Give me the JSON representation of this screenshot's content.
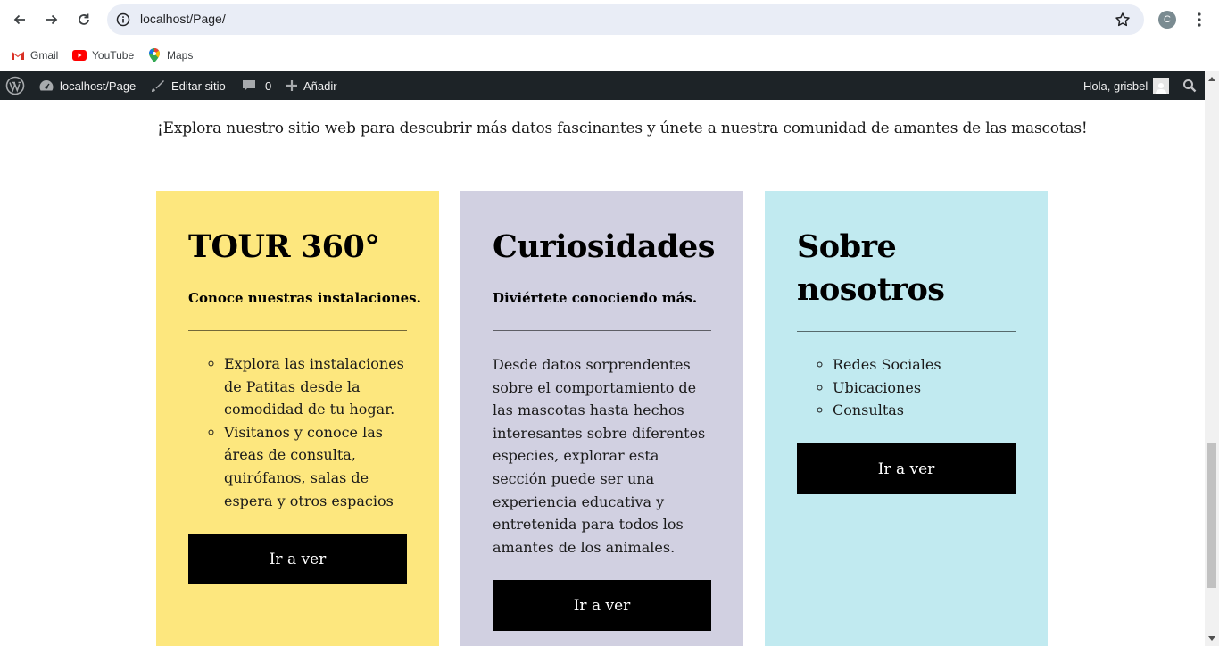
{
  "browser": {
    "url": "localhost/Page/",
    "profile_initial": "C",
    "bookmarks": [
      {
        "label": "Gmail",
        "icon": "gmail-icon"
      },
      {
        "label": "YouTube",
        "icon": "youtube-icon"
      },
      {
        "label": "Maps",
        "icon": "maps-icon"
      }
    ]
  },
  "admin_bar": {
    "site": "localhost/Page",
    "edit": "Editar sitio",
    "comments": "0",
    "add": "Añadir",
    "greeting": "Hola, grisbel"
  },
  "page": {
    "intro": "¡Explora nuestro sitio web para descubrir más datos fascinantes y únete a nuestra comunidad de amantes de las mascotas!",
    "cards": [
      {
        "title": "TOUR 360°",
        "subtitle": "Conoce nuestras instalaciones.",
        "items": [
          "Explora las instalaciones de Patitas desde la comodidad de tu hogar.",
          "Visitanos y conoce las áreas de consulta, quirófanos, salas de espera y otros espacios"
        ],
        "button": "Ir a ver",
        "bg": "#fde77e"
      },
      {
        "title": "Curiosidades",
        "subtitle": "Diviértete conociendo más.",
        "body": "Desde datos sorprendentes sobre el comportamiento de las mascotas hasta hechos interesantes sobre diferentes especies, explorar esta sección puede ser una experiencia educativa y entretenida para todos los amantes de los animales.",
        "button": "Ir a ver",
        "bg": "#d1d0e1"
      },
      {
        "title": "Sobre nosotros",
        "items": [
          "Redes Sociales",
          "Ubicaciones",
          "Consultas"
        ],
        "button": "Ir a ver",
        "bg": "#c1eaf0"
      }
    ]
  }
}
